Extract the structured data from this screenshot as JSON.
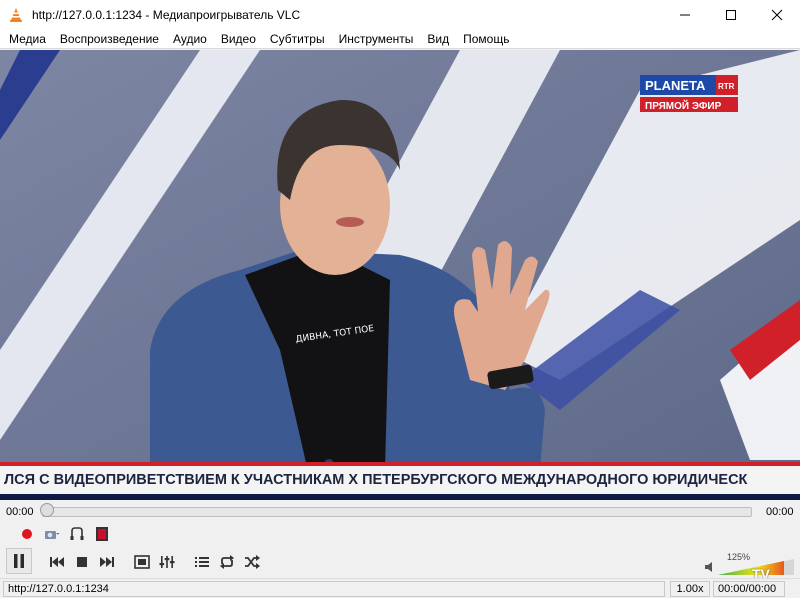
{
  "window": {
    "title": "http://127.0.0.1:1234 - Медиапроигрыватель VLC"
  },
  "menu": {
    "items": [
      "Медиа",
      "Воспроизведение",
      "Аудио",
      "Видео",
      "Субтитры",
      "Инструменты",
      "Вид",
      "Помощь"
    ]
  },
  "video": {
    "channel_logo_main": "PLANETA",
    "channel_logo_badge": "RTR",
    "live_label": "ПРЯМОЙ ЭФИР",
    "shirt_text": "ДИВНА, ТОТ ПОЕ",
    "ticker": "ЛСЯ С ВИДЕОПРИВЕТСТВИЕМ К УЧАСТНИКАМ X ПЕТЕРБУРГСКОГО МЕЖДУНАРОДНОГО ЮРИДИЧЕСК",
    "watermark": "TV"
  },
  "controls": {
    "time_elapsed": "00:00",
    "time_total": "00:00",
    "seek_position": 0,
    "volume_label": "125%",
    "volume_level": 1.25
  },
  "status": {
    "url": "http://127.0.0.1:1234",
    "speed": "1.00x",
    "time": "00:00/00:00"
  },
  "colors": {
    "accent_red": "#d0202a",
    "vlc_orange": "#f58220",
    "ticker_bg": "#f4f4f4",
    "ticker_text": "#1b2440",
    "jacket": "#3c5a91"
  }
}
